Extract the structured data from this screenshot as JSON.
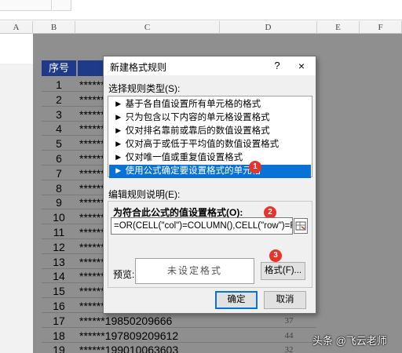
{
  "columns": [
    "A",
    "B",
    "C",
    "D",
    "E",
    "F"
  ],
  "sheet": {
    "header": "序号",
    "rows": [
      {
        "num": "1",
        "text": "******",
        "val": ""
      },
      {
        "num": "2",
        "text": "******",
        "val": ""
      },
      {
        "num": "3",
        "text": "******",
        "val": ""
      },
      {
        "num": "4",
        "text": "******",
        "val": ""
      },
      {
        "num": "5",
        "text": "******",
        "val": ""
      },
      {
        "num": "6",
        "text": "******",
        "val": ""
      },
      {
        "num": "7",
        "text": "******",
        "val": ""
      },
      {
        "num": "8",
        "text": "******",
        "val": ""
      },
      {
        "num": "9",
        "text": "******",
        "val": ""
      },
      {
        "num": "10",
        "text": "******",
        "val": ""
      },
      {
        "num": "11",
        "text": "******",
        "val": ""
      },
      {
        "num": "12",
        "text": "******",
        "val": ""
      },
      {
        "num": "13",
        "text": "******",
        "val": ""
      },
      {
        "num": "14",
        "text": "******",
        "val": ""
      },
      {
        "num": "15",
        "text": "******",
        "val": ""
      },
      {
        "num": "16",
        "text": "******",
        "val": ""
      },
      {
        "num": "17",
        "text": "******19850209666",
        "val": "37"
      },
      {
        "num": "18",
        "text": "******197809209612",
        "val": "44"
      },
      {
        "num": "19",
        "text": "******199010063603",
        "val": "32"
      }
    ]
  },
  "dialog": {
    "title": "新建格式规则",
    "help": "?",
    "close": "×",
    "select_type_label": "选择规则类型(S):",
    "rule_types": [
      "► 基于各自值设置所有单元格的格式",
      "► 只为包含以下内容的单元格设置格式",
      "► 仅对排名靠前或靠后的数值设置格式",
      "► 仅对高于或低于平均值的数值设置格式",
      "► 仅对唯一值或重复值设置格式",
      "► 使用公式确定要设置格式的单元格"
    ],
    "selected_index": 5,
    "edit_label": "编辑规则说明(E):",
    "formula_label": "为符合此公式的值设置格式(O):",
    "formula": "=OR(CELL(\"col\")=COLUMN(),CELL(\"row\")=ROW())",
    "preview_label": "预览:",
    "preview_text": "未设定格式",
    "format_button": "格式(F)...",
    "ok_button": "确定",
    "cancel_button": "取消"
  },
  "badges": [
    "1",
    "2",
    "3"
  ],
  "watermark": "头条 @飞云老师",
  "colors": {
    "header_bg": "#1f3a8a",
    "selection": "#0a72d4",
    "badge": "#e8322c",
    "overlay": "#8f8f8f"
  }
}
